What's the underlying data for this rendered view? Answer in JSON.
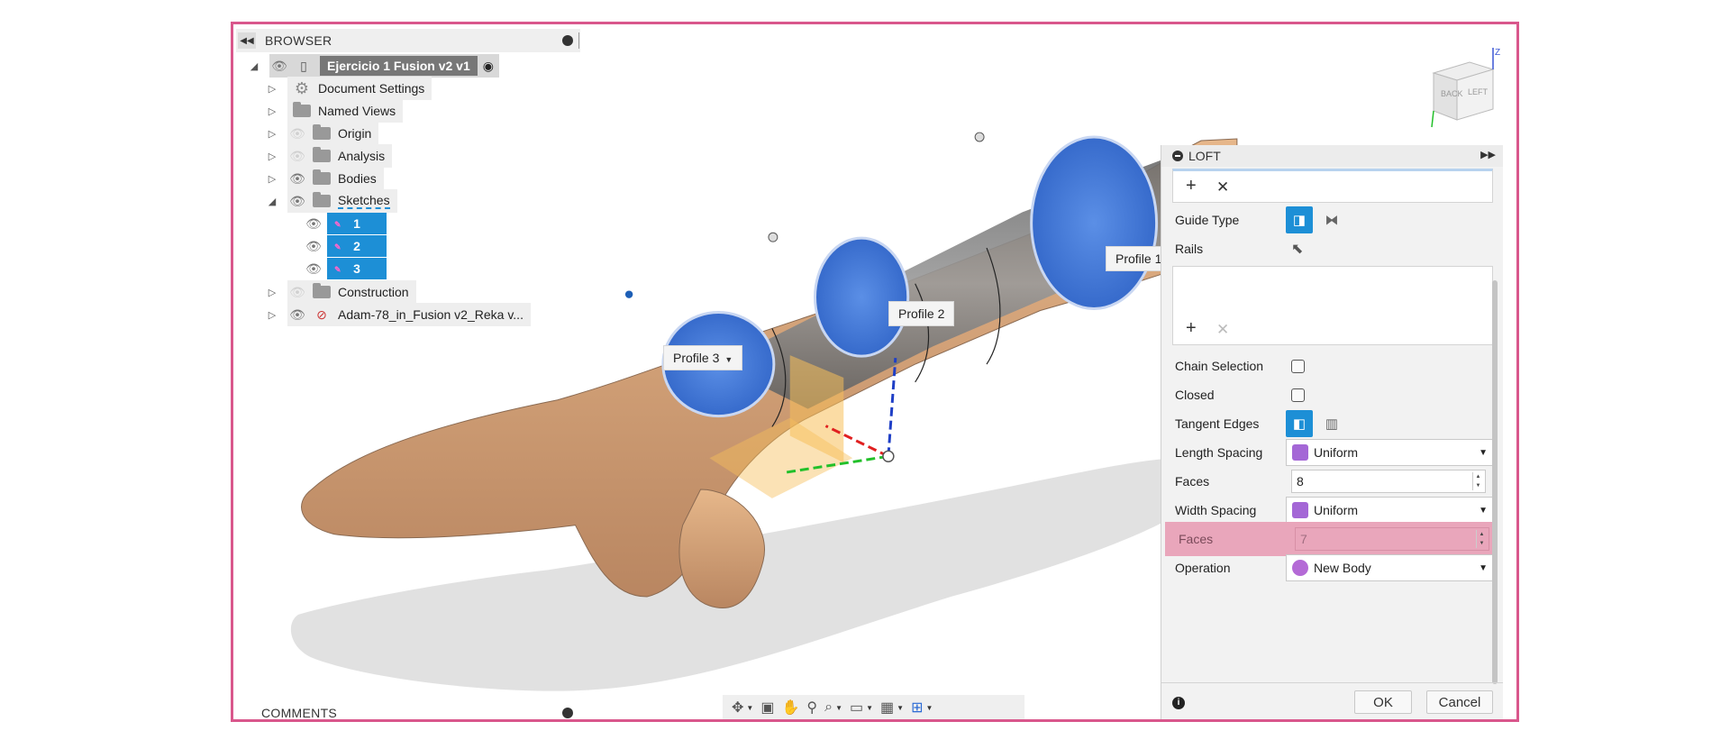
{
  "browser": {
    "title": "BROWSER",
    "root_label": "Ejercicio 1 Fusion v2 v1",
    "items": [
      {
        "label": "Document Settings"
      },
      {
        "label": "Named Views"
      },
      {
        "label": "Origin"
      },
      {
        "label": "Analysis"
      },
      {
        "label": "Bodies"
      },
      {
        "label": "Sketches"
      },
      {
        "label": "Construction"
      },
      {
        "label": "Adam-78_in_Fusion v2_Reka v..."
      }
    ],
    "sketches": [
      {
        "label": "1"
      },
      {
        "label": "2"
      },
      {
        "label": "3"
      }
    ]
  },
  "comments": {
    "title": "COMMENTS"
  },
  "profiles": {
    "p1": "Profile 1",
    "p2": "Profile 2",
    "p3": "Profile 3"
  },
  "viewcube": {
    "faces": [
      "BACK",
      "LEFT"
    ],
    "axis_z": "Z"
  },
  "loft": {
    "title": "LOFT",
    "guide_type_label": "Guide Type",
    "rails_label": "Rails",
    "chain_selection_label": "Chain Selection",
    "closed_label": "Closed",
    "tangent_edges_label": "Tangent Edges",
    "length_spacing_label": "Length Spacing",
    "length_spacing_value": "Uniform",
    "faces_label": "Faces",
    "faces_value": "8",
    "width_spacing_label": "Width Spacing",
    "width_spacing_value": "Uniform",
    "faces2_label": "Faces",
    "faces2_value": "7",
    "operation_label": "Operation",
    "operation_value": "New Body",
    "ok_label": "OK",
    "cancel_label": "Cancel"
  },
  "colors": {
    "accent": "#1d8fd6",
    "frame": "#d9578c",
    "highlight": "#e9a6bb",
    "skin": "#d9a77b",
    "profile_blue": "#3a72d4"
  }
}
